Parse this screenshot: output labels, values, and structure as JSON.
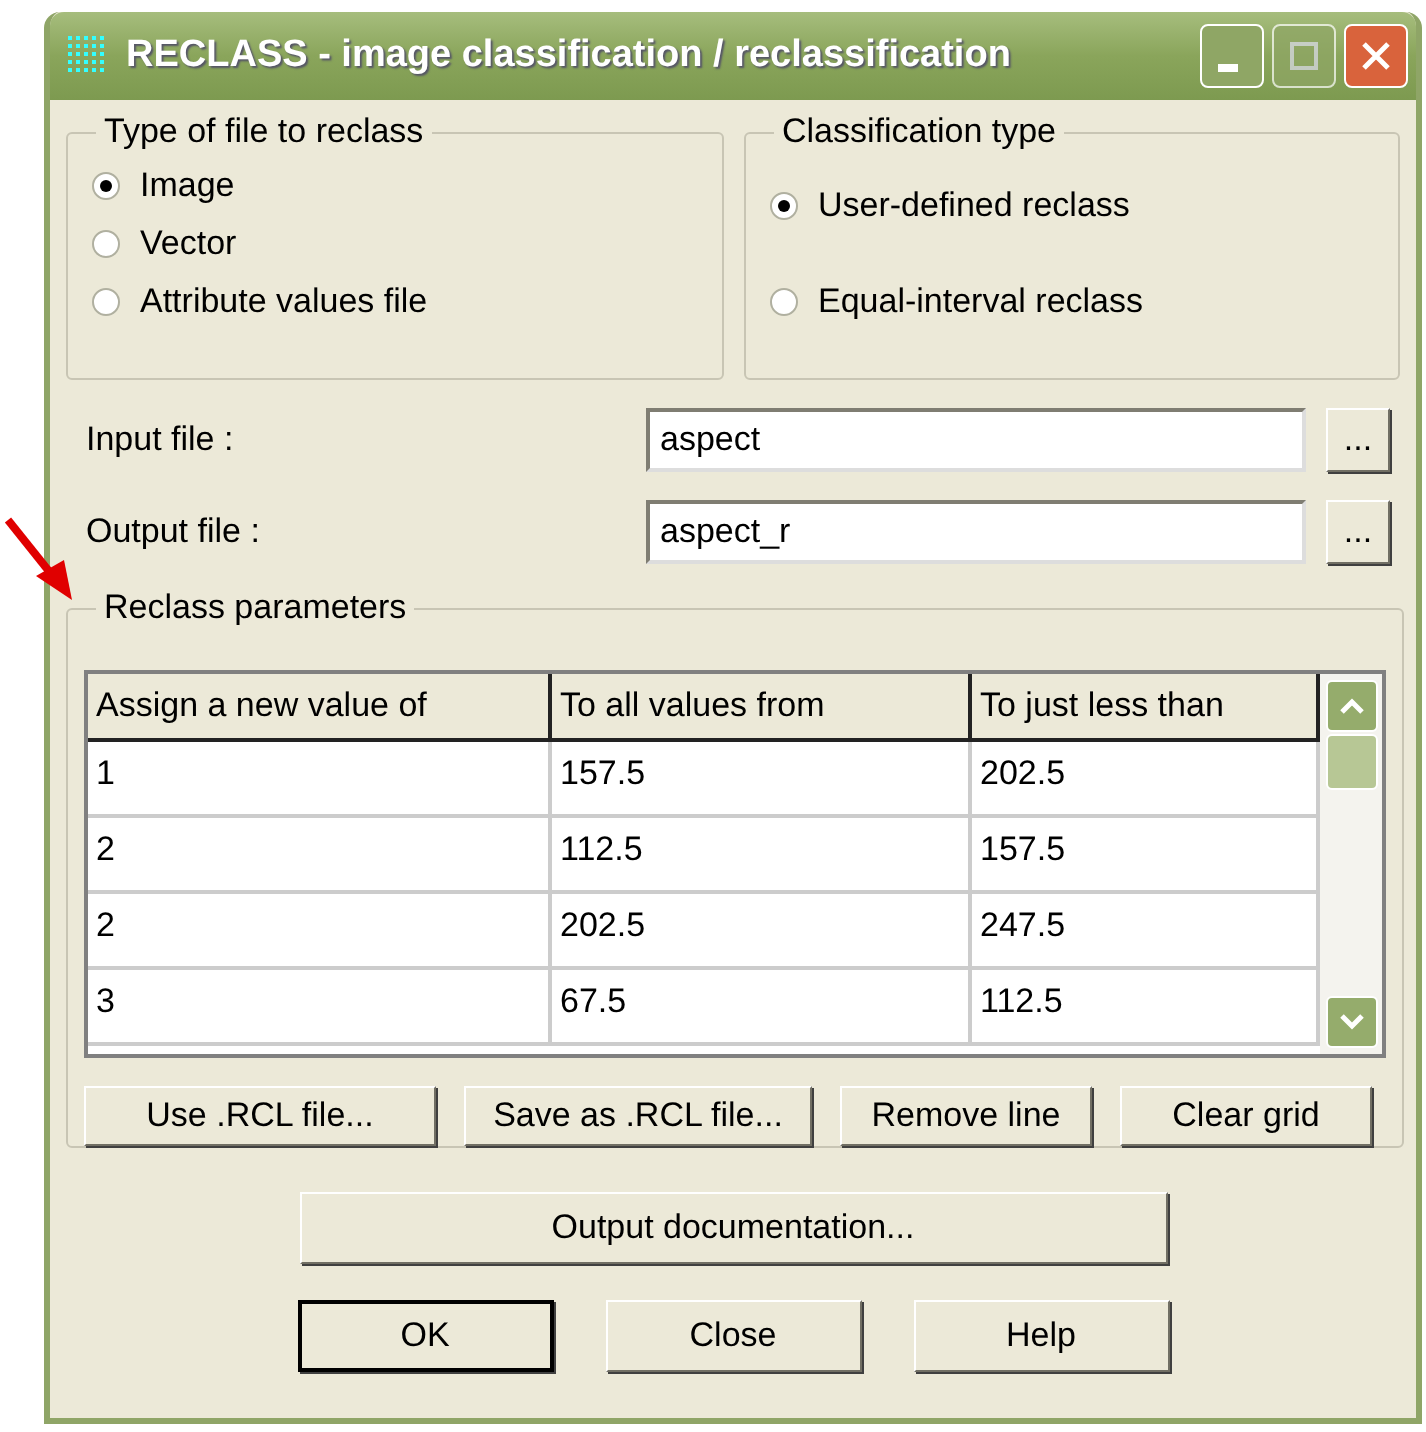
{
  "window": {
    "title": "RECLASS - image classification / reclassification"
  },
  "file_type": {
    "legend": "Type of file to reclass",
    "options": [
      {
        "label": "Image",
        "selected": true
      },
      {
        "label": "Vector",
        "selected": false
      },
      {
        "label": "Attribute values file",
        "selected": false
      }
    ]
  },
  "classification_type": {
    "legend": "Classification type",
    "options": [
      {
        "label": "User-defined reclass",
        "selected": true
      },
      {
        "label": "Equal-interval reclass",
        "selected": false
      }
    ]
  },
  "files": [
    {
      "label": "Input file :",
      "value": "aspect",
      "browse": "..."
    },
    {
      "label": "Output file :",
      "value": "aspect_r",
      "browse": "..."
    }
  ],
  "reclass_parameters": {
    "legend": "Reclass parameters",
    "columns": [
      "Assign a new value of",
      "To all values from",
      "To just less than"
    ],
    "rows": [
      [
        "1",
        "157.5",
        "202.5"
      ],
      [
        "2",
        "112.5",
        "157.5"
      ],
      [
        "2",
        "202.5",
        "247.5"
      ],
      [
        "3",
        "67.5",
        "112.5"
      ]
    ],
    "buttons": [
      "Use .RCL file...",
      "Save as .RCL file...",
      "Remove line",
      "Clear grid"
    ]
  },
  "output_documentation": "Output documentation...",
  "buttons": [
    {
      "label": "OK",
      "default": true
    },
    {
      "label": "Close",
      "default": false
    },
    {
      "label": "Help",
      "default": false
    }
  ]
}
